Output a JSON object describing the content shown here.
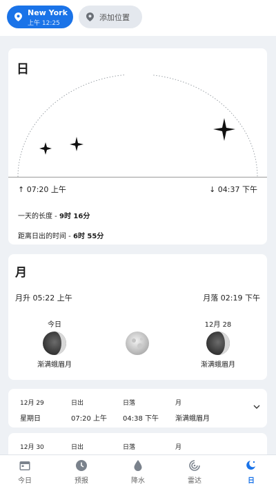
{
  "header": {
    "location_chip": {
      "city": "New York",
      "time": "上午 12:25",
      "icon": "location-pin-icon"
    },
    "add_chip": {
      "label": "添加位置",
      "icon": "location-pin-icon"
    }
  },
  "sun": {
    "title": "日",
    "sunrise": "07:20 上午",
    "sunset": "04:37 下午",
    "day_length_label": "一天的长度 -",
    "day_length_value": "9时 16分",
    "until_sunrise_label": "距离日出的时间 -",
    "until_sunrise_value": "6时 55分"
  },
  "moon": {
    "title": "月",
    "moonrise_label": "月升",
    "moonrise": "05:22 上午",
    "moonset_label": "月落",
    "moonset": "02:19 下午",
    "phases": [
      {
        "day": "今日",
        "phase": "渐满蛾眉月"
      },
      {
        "day": "",
        "phase": ""
      },
      {
        "day": "12月 28",
        "phase": "渐满蛾眉月"
      }
    ]
  },
  "days": [
    {
      "date": "12月 29",
      "weekday": "星期日",
      "sunrise_label": "日出",
      "sunrise": "07:20 上午",
      "sunset_label": "日落",
      "sunset": "04:38 下午",
      "moon_label": "月",
      "moon": "渐满蛾眉月"
    },
    {
      "date": "12月 30",
      "weekday": "",
      "sunrise_label": "日出",
      "sunrise": "",
      "sunset_label": "日落",
      "sunset": "",
      "moon_label": "月",
      "moon": ""
    }
  ],
  "nav": [
    {
      "label": "今日",
      "icon": "calendar-icon"
    },
    {
      "label": "预报",
      "icon": "clock-icon"
    },
    {
      "label": "降水",
      "icon": "water-drop-icon"
    },
    {
      "label": "雷达",
      "icon": "radar-icon"
    },
    {
      "label": "日",
      "icon": "sun-moon-icon",
      "active": true
    }
  ],
  "colors": {
    "accent": "#1a73e8",
    "background": "#eef1f5",
    "card": "#ffffff"
  }
}
